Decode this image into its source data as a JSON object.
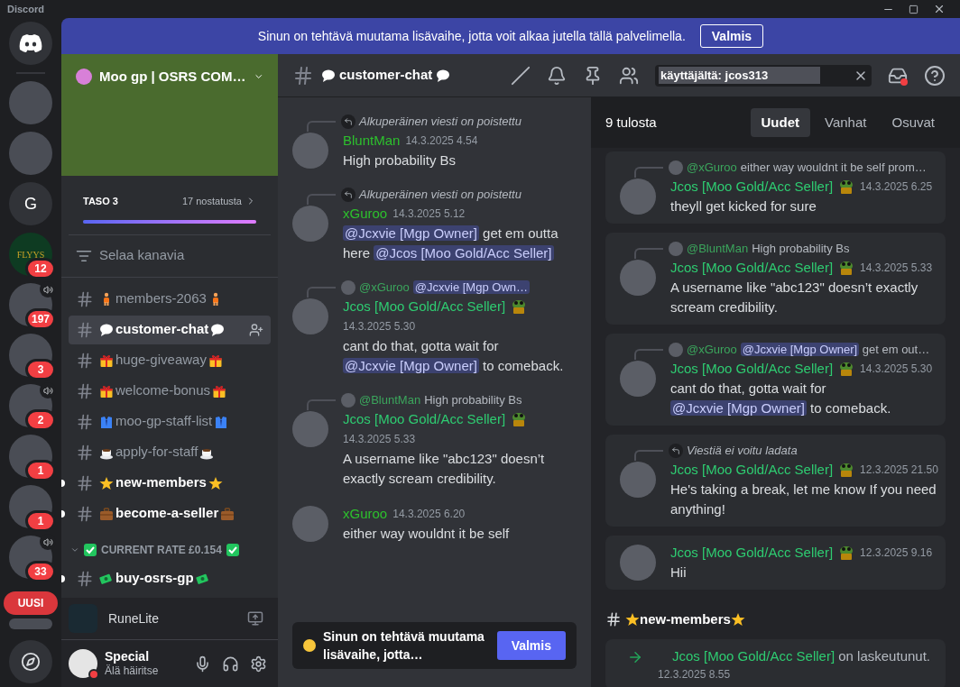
{
  "window": {
    "title": "Discord"
  },
  "notice": {
    "text": "Sinun on tehtävä muutama lisävaihe, jotta voit alkaa jutella tällä palvelimella.",
    "button": "Valmis"
  },
  "servers": [
    {
      "kind": "image",
      "speaker": false
    },
    {
      "kind": "image",
      "speaker": false
    },
    {
      "kind": "letter",
      "label": "G",
      "speaker": false
    },
    {
      "kind": "wordmark",
      "label": "FLYYS",
      "badge": "12",
      "speaker": false
    },
    {
      "kind": "image",
      "badge": "197",
      "speaker": true
    },
    {
      "kind": "image",
      "badge": "3",
      "speaker": false
    },
    {
      "kind": "image",
      "badge": "2",
      "speaker": true
    },
    {
      "kind": "image",
      "badge": "1",
      "speaker": false
    },
    {
      "kind": "image",
      "badge": "1",
      "speaker": false
    },
    {
      "kind": "image",
      "badge": "33",
      "speaker": true
    },
    {
      "kind": "image",
      "pill": "UUSI"
    }
  ],
  "server": {
    "name": "Moo gp | OSRS COM…",
    "boost_level": "TASO 3",
    "boosts": "17 nostatusta",
    "level": 1,
    "browse": "Selaa kanavia"
  },
  "channels": [
    {
      "kind": "channel",
      "name": "members-2063",
      "selected": false,
      "unread": false
    },
    {
      "kind": "channel",
      "name": "customer-chat",
      "selected": true,
      "unread": false
    },
    {
      "kind": "channel",
      "name": "huge-giveaway",
      "selected": false,
      "unread": false
    },
    {
      "kind": "channel",
      "name": "welcome-bonus",
      "selected": false,
      "unread": false
    },
    {
      "kind": "channel",
      "name": "moo-gp-staff-list",
      "selected": false,
      "unread": false
    },
    {
      "kind": "channel",
      "name": "apply-for-staff",
      "selected": false,
      "unread": false
    },
    {
      "kind": "channel",
      "name": "new-members",
      "selected": false,
      "unread": true
    },
    {
      "kind": "channel",
      "name": "become-a-seller",
      "selected": false,
      "unread": true
    },
    {
      "kind": "category",
      "name": "CURRENT RATE £0.154",
      "expanded": true
    },
    {
      "kind": "channel",
      "name": "buy-osrs-gp",
      "selected": false,
      "unread": true
    }
  ],
  "activity": {
    "name": "RuneLite"
  },
  "user": {
    "name": "Special",
    "status_text": "Älä häiritse",
    "do_not_disturb": true
  },
  "header": {
    "channel": "customer-chat",
    "search": "käyttäjältä: jcos313"
  },
  "messages": [
    {
      "reply": {
        "kind": "deleted",
        "text": "Alkuperäinen viesti on poistettu"
      },
      "author": "BluntMan",
      "color": "#2dc02d",
      "time": "14.3.2025 4.54",
      "content": [
        {
          "text": "High probability Bs",
          "mention": false
        }
      ]
    },
    {
      "reply": {
        "kind": "deleted",
        "text": "Alkuperäinen viesti on poistettu"
      },
      "author": "xGuroo",
      "color": "#2dc02d",
      "time": "14.3.2025 5.12",
      "content": [
        {
          "text": "@Jcxvie [Mgp Owner]",
          "mention": true
        },
        {
          "text": " get em outta here ",
          "mention": false
        },
        {
          "text": "@Jcos [Moo Gold/Acc Seller]",
          "mention": true
        }
      ]
    },
    {
      "reply": {
        "kind": "user",
        "author": "@xGuroo",
        "content": [
          {
            "text": "@Jcxvie [Mgp Own…",
            "mention": true
          }
        ]
      },
      "author": "Jcos [Moo Gold/Acc Seller]",
      "color": "#2ecc71",
      "role_icon": true,
      "time": "14.3.2025 5.30",
      "content": [
        {
          "text": "cant do that, gotta wait for ",
          "mention": false
        },
        {
          "text": "@Jcxvie [Mgp Owner]",
          "mention": true
        },
        {
          "text": " to comeback.",
          "mention": false
        }
      ]
    },
    {
      "reply": {
        "kind": "user",
        "author": "@BluntMan",
        "content": [
          {
            "text": "High probability Bs",
            "mention": false
          }
        ]
      },
      "author": "Jcos [Moo Gold/Acc Seller]",
      "color": "#2ecc71",
      "role_icon": true,
      "time": "14.3.2025 5.33",
      "content": [
        {
          "text": "A username like \"abc123\" doesn’t exactly scream credibility.",
          "mention": false
        }
      ]
    },
    {
      "author": "xGuroo",
      "color": "#2dc02d",
      "time": "14.3.2025 6.20",
      "content": [
        {
          "text": "either way wouldnt it be self",
          "mention": false
        }
      ]
    }
  ],
  "toast": {
    "text": "Sinun on tehtävä muutama lisävaihe, jotta…",
    "button": "Valmis"
  },
  "search": {
    "count": "9 tulosta",
    "tabs": [
      {
        "label": "Uudet",
        "selected": true
      },
      {
        "label": "Vanhat",
        "selected": false
      },
      {
        "label": "Osuvat",
        "selected": false
      }
    ],
    "results": [
      {
        "kind": "message",
        "reply": {
          "kind": "user",
          "author": "@xGuroo",
          "content": [
            {
              "text": "either way wouldnt it be self prom…",
              "mention": false
            }
          ]
        },
        "author": "Jcos [Moo Gold/Acc Seller]",
        "color": "#2ecc71",
        "role_icon": true,
        "time": "14.3.2025 6.25",
        "content": [
          {
            "text": "theyll get kicked for sure",
            "mention": false
          }
        ]
      },
      {
        "kind": "message",
        "reply": {
          "kind": "user",
          "author": "@BluntMan",
          "content": [
            {
              "text": "High probability Bs",
              "mention": false
            }
          ]
        },
        "author": "Jcos [Moo Gold/Acc Seller]",
        "color": "#2ecc71",
        "role_icon": true,
        "time": "14.3.2025 5.33",
        "content": [
          {
            "text": "A username like \"abc123\" doesn’t exactly scream credibility.",
            "mention": false
          }
        ]
      },
      {
        "kind": "message",
        "reply": {
          "kind": "user",
          "author": "@xGuroo",
          "content": [
            {
              "text": "@Jcxvie [Mgp Owner]",
              "mention": true
            },
            {
              "text": " get em out…",
              "mention": false
            }
          ]
        },
        "author": "Jcos [Moo Gold/Acc Seller]",
        "color": "#2ecc71",
        "role_icon": true,
        "time": "14.3.2025 5.30",
        "content": [
          {
            "text": "cant do that, gotta wait for ",
            "mention": false
          },
          {
            "text": "@Jcxvie [Mgp Owner]",
            "mention": true
          },
          {
            "text": " to comeback.",
            "mention": false
          }
        ]
      },
      {
        "kind": "message",
        "reply": {
          "kind": "deleted",
          "text": "Viestiä ei voitu ladata"
        },
        "author": "Jcos [Moo Gold/Acc Seller]",
        "color": "#2ecc71",
        "role_icon": true,
        "time": "12.3.2025 21.50",
        "content": [
          {
            "text": "He's taking a break, let me know If you need anything!",
            "mention": false
          }
        ]
      },
      {
        "kind": "message",
        "author": "Jcos [Moo Gold/Acc Seller]",
        "color": "#2ecc71",
        "role_icon": true,
        "time": "12.3.2025 9.16",
        "content": [
          {
            "text": "Hii",
            "mention": false
          }
        ]
      },
      {
        "kind": "channel_header",
        "name": "new-members"
      },
      {
        "kind": "join",
        "author": "Jcos [Moo Gold/Acc Seller]",
        "color": "#2ecc71",
        "text": "on laskeutunut.",
        "time": "12.3.2025 8.55"
      }
    ]
  }
}
